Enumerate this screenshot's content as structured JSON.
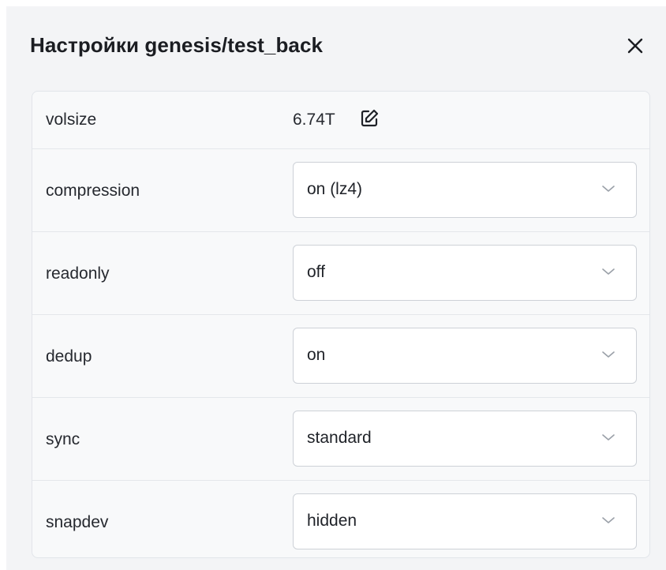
{
  "dialog": {
    "title": "Настройки genesis/test_back",
    "close_icon": "close-icon"
  },
  "properties": [
    {
      "label": "volsize",
      "value": "6.74T",
      "kind": "editable",
      "icon": "edit-icon"
    },
    {
      "label": "compression",
      "value": "on (lz4)",
      "kind": "select"
    },
    {
      "label": "readonly",
      "value": "off",
      "kind": "select"
    },
    {
      "label": "dedup",
      "value": "on",
      "kind": "select"
    },
    {
      "label": "sync",
      "value": "standard",
      "kind": "select"
    },
    {
      "label": "snapdev",
      "value": "hidden",
      "kind": "select"
    }
  ],
  "colors": {
    "dialog_bg": "#f3f4f6",
    "card_bg": "#f8f9fa",
    "select_bg": "#ffffff",
    "border": "#cdd1d7",
    "chevron": "#9aa0a8"
  }
}
